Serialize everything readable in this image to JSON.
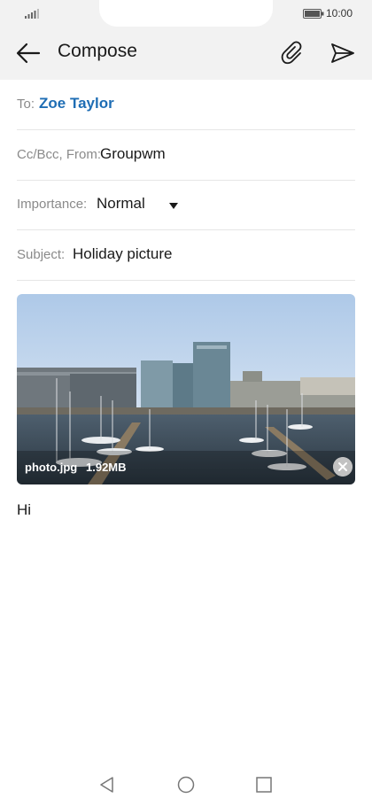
{
  "status": {
    "time": "10:00"
  },
  "appbar": {
    "title": "Compose"
  },
  "form": {
    "to_label": "To:",
    "to_value": "Zoe Taylor",
    "ccbcc_label": "Cc/Bcc, From:",
    "from_value": "Groupwm",
    "importance_label": "Importance:",
    "importance_value": "Normal",
    "subject_label": "Subject:",
    "subject_value": "Holiday picture"
  },
  "attachment": {
    "file_name": "photo.jpg",
    "file_size": "1.92MB"
  },
  "message": {
    "body": "Hi"
  },
  "colors": {
    "accent": "#1e6db4",
    "bar_bg": "#f2f2f2"
  }
}
